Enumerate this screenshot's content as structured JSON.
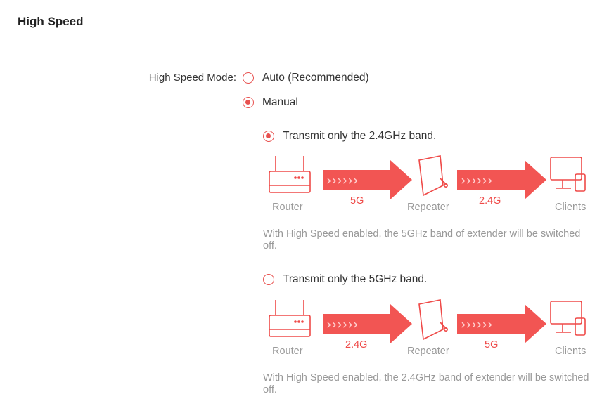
{
  "section": {
    "title": "High Speed"
  },
  "high_speed_mode": {
    "label": "High Speed Mode:",
    "options": [
      {
        "label": "Auto (Recommended)",
        "checked": false
      },
      {
        "label": "Manual",
        "checked": true
      }
    ]
  },
  "band_options": [
    {
      "label": "Transmit only the 2.4GHz band.",
      "checked": true,
      "diagram": {
        "router": "Router",
        "repeater": "Repeater",
        "clients": "Clients",
        "band_in": "5G",
        "band_out": "2.4G"
      },
      "description": " With High Speed enabled, the 5GHz band of extender will be switched off."
    },
    {
      "label": "Transmit only the 5GHz band.",
      "checked": false,
      "diagram": {
        "router": "Router",
        "repeater": "Repeater",
        "clients": "Clients",
        "band_in": "2.4G",
        "band_out": "5G"
      },
      "description": "With High Speed enabled, the 2.4GHz band of extender will be switched off."
    }
  ],
  "colors": {
    "accent": "#e8514f",
    "arrow": "#f25553",
    "icon": "#ef4a48",
    "muted_text": "#999999"
  },
  "icons": {
    "router": "router-icon",
    "repeater": "repeater-icon",
    "clients": "clients-icon",
    "arrow": "signal-arrow-icon"
  }
}
